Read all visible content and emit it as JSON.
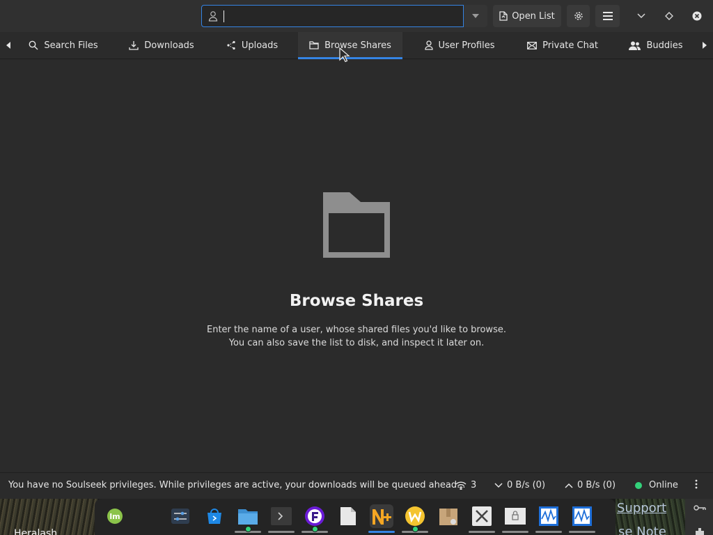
{
  "header": {
    "username_input": {
      "value": "",
      "placeholder": ""
    },
    "open_list_label": "Open List"
  },
  "tabs": [
    {
      "label": "Search Files",
      "icon": "search-icon"
    },
    {
      "label": "Downloads",
      "icon": "download-icon"
    },
    {
      "label": "Uploads",
      "icon": "share-icon"
    },
    {
      "label": "Browse Shares",
      "icon": "folder-icon",
      "active": true
    },
    {
      "label": "User Profiles",
      "icon": "user-icon"
    },
    {
      "label": "Private Chat",
      "icon": "mail-icon"
    },
    {
      "label": "Buddies",
      "icon": "users-icon"
    }
  ],
  "empty_state": {
    "title": "Browse Shares",
    "description": "Enter the name of a user, whose shared files you'd like to browse. You can also save the list to disk, and inspect it later on."
  },
  "statusbar": {
    "message": "You have no Soulseek privileges. While privileges are active, your downloads will be queued ahead...",
    "connections": "3",
    "download_speed": "0 B/s (0)",
    "upload_speed": "0 B/s (0)",
    "status": "Online"
  },
  "desktop": {
    "wallpaper_text_left": "Heralash",
    "wallpaper_link_1": "Support",
    "wallpaper_link_2": "se Note"
  },
  "colors": {
    "accent": "#3584e4",
    "online": "#33d17a",
    "background": "#2b2b2b"
  }
}
